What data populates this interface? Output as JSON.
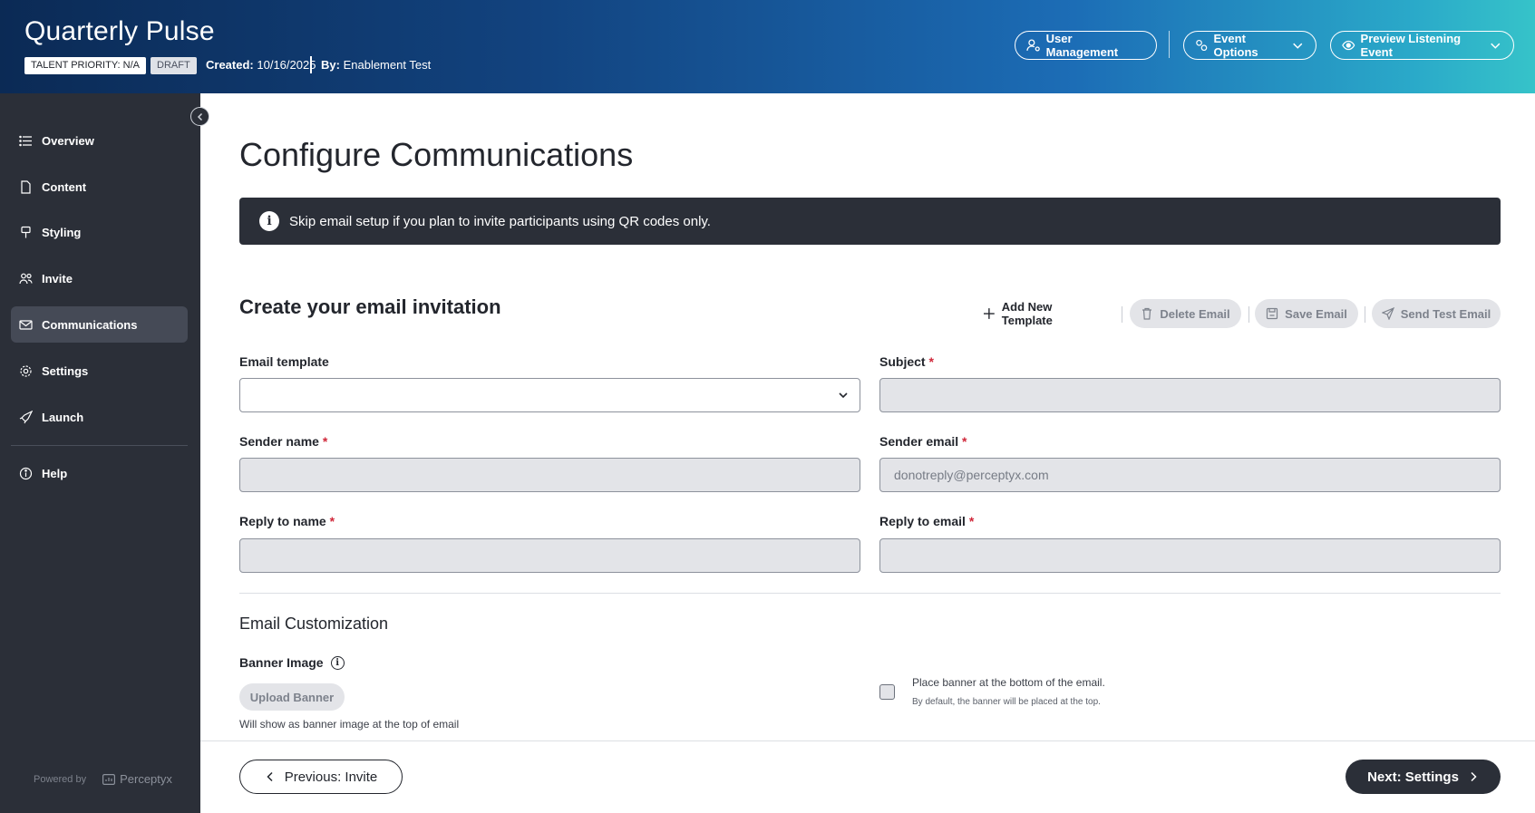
{
  "header": {
    "title": "Quarterly Pulse",
    "priority_badge": "TALENT PRIORITY: N/A",
    "status_badge": "DRAFT",
    "created_label": "Created:",
    "created_value": "10/16/2025",
    "by_label": "By:",
    "by_value": "Enablement Test",
    "buttons": {
      "user_management": "User Management",
      "event_options": "Event Options",
      "preview": "Preview Listening Event"
    }
  },
  "sidebar": {
    "items": [
      {
        "label": "Overview",
        "icon": "list-icon"
      },
      {
        "label": "Content",
        "icon": "document-icon"
      },
      {
        "label": "Styling",
        "icon": "paint-icon"
      },
      {
        "label": "Invite",
        "icon": "users-icon"
      },
      {
        "label": "Communications",
        "icon": "mail-icon",
        "active": true
      },
      {
        "label": "Settings",
        "icon": "gear-icon"
      },
      {
        "label": "Launch",
        "icon": "rocket-icon"
      },
      {
        "label": "Help",
        "icon": "info-icon"
      }
    ],
    "powered_by": "Powered by",
    "brand": "Perceptyx"
  },
  "main": {
    "page_title": "Configure Communications",
    "info_banner": "Skip email setup if you plan to invite participants using QR codes only.",
    "section_title": "Create your email invitation",
    "actions": {
      "add_template": "Add New Template",
      "delete_email": "Delete Email",
      "save_email": "Save Email",
      "send_test": "Send Test Email"
    },
    "fields": {
      "email_template": {
        "label": "Email template",
        "value": ""
      },
      "subject": {
        "label": "Subject",
        "required": "*",
        "value": ""
      },
      "sender_name": {
        "label": "Sender name",
        "required": "*",
        "value": ""
      },
      "sender_email": {
        "label": "Sender email",
        "required": "*",
        "value": "donotreply@perceptyx.com"
      },
      "reply_to_name": {
        "label": "Reply to name",
        "required": "*",
        "value": ""
      },
      "reply_to_email": {
        "label": "Reply to email",
        "required": "*",
        "value": ""
      }
    },
    "customization": {
      "title": "Email Customization",
      "banner_label": "Banner Image",
      "upload_button": "Upload Banner",
      "upload_hint": "Will show as banner image at the top of email",
      "checkbox_label": "Place banner at the bottom of the email.",
      "checkbox_sub": "By default, the banner will be placed at the top.",
      "checkbox_checked": false
    }
  },
  "footer": {
    "previous": "Previous: Invite",
    "next": "Next: Settings"
  }
}
